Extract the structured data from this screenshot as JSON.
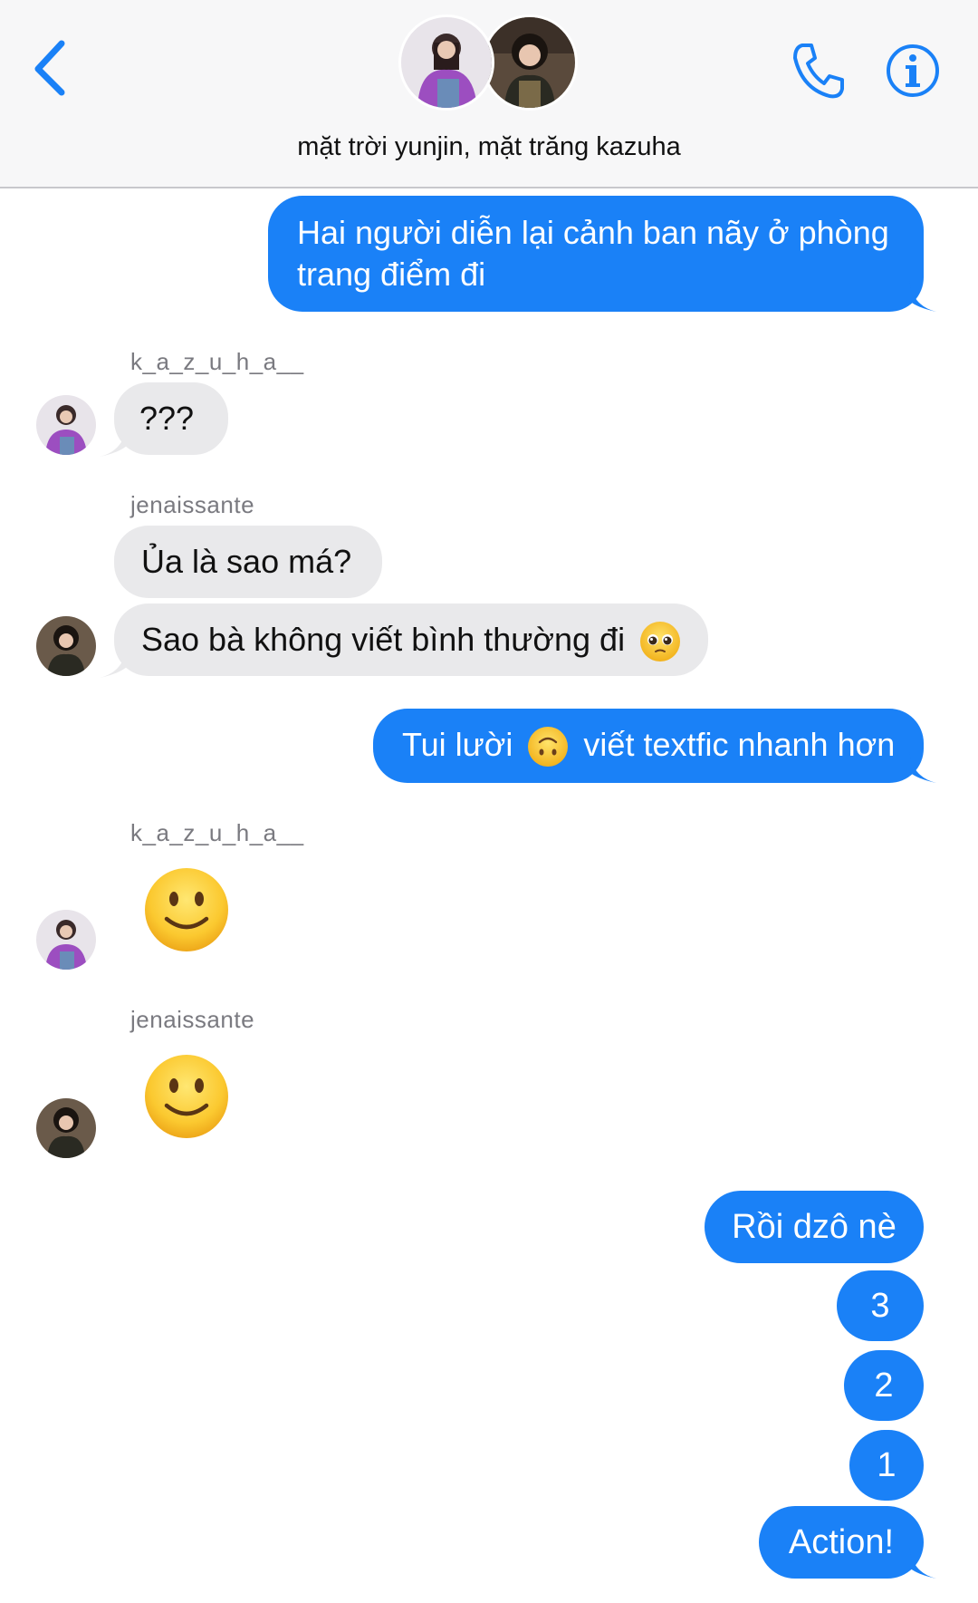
{
  "header": {
    "title": "mặt trời yunjin, mặt trăng kazuha",
    "back_icon": "chevron-left-icon",
    "call_icon": "phone-icon",
    "info_icon": "info-icon",
    "accent_color": "#1a81f7"
  },
  "messages": [
    {
      "from": "me",
      "line1": "Hai người diễn lại cảnh ban nãy ở phòng",
      "line2": "trang điểm đi"
    },
    {
      "from": "k_a_z_u_h_a__",
      "sender": "k_a_z_u_h_a__",
      "text": "???"
    },
    {
      "from": "jenaissante",
      "sender": "jenaissante",
      "text1": "Ủa là sao má?",
      "text2": "Sao bà không viết bình thường đi"
    },
    {
      "from": "me",
      "before": "Tui lười",
      "after": "viết textfic nhanh hơn"
    },
    {
      "from": "k_a_z_u_h_a__",
      "sender": "k_a_z_u_h_a__",
      "emoji": "slightly-smiling-face"
    },
    {
      "from": "jenaissante",
      "sender": "jenaissante",
      "emoji": "slightly-smiling-face"
    },
    {
      "from": "me",
      "texts": [
        "Rồi dzô nè",
        "3",
        "2",
        "1",
        "Action!"
      ]
    }
  ]
}
